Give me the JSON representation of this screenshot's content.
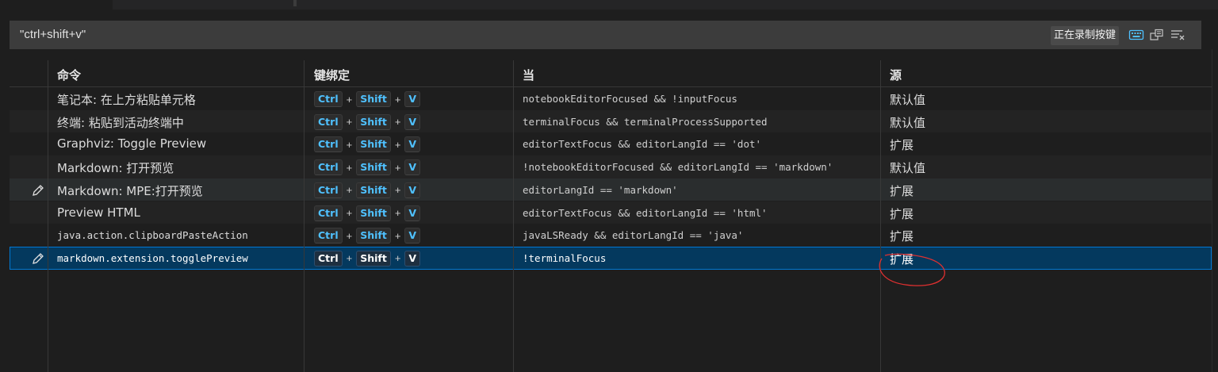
{
  "search": {
    "query": "\"ctrl+shift+v\"",
    "recording_label": "正在录制按键"
  },
  "icons": {
    "keyboard": "keyboard-icon",
    "sort": "sort-by-precedence-icon",
    "clear": "clear-icon",
    "edit": "pencil-icon"
  },
  "colors": {
    "accent": "#4fc1ff",
    "selection": "#04395e",
    "focus_border": "#0078d4",
    "annotation": "#e03030"
  },
  "table": {
    "headers": {
      "command": "命令",
      "keybinding": "键绑定",
      "when": "当",
      "source": "源"
    },
    "rows": [
      {
        "command": "笔记本: 在上方粘贴单元格",
        "keys": [
          "Ctrl",
          "Shift",
          "V"
        ],
        "when": "notebookEditorFocused && !inputFocus",
        "source": "默认值"
      },
      {
        "command": "终端: 粘贴到活动终端中",
        "keys": [
          "Ctrl",
          "Shift",
          "V"
        ],
        "when": "terminalFocus && terminalProcessSupported",
        "source": "默认值"
      },
      {
        "command": "Graphviz: Toggle Preview",
        "keys": [
          "Ctrl",
          "Shift",
          "V"
        ],
        "when": "editorTextFocus && editorLangId == 'dot'",
        "source": "扩展"
      },
      {
        "command": "Markdown: 打开预览",
        "keys": [
          "Ctrl",
          "Shift",
          "V"
        ],
        "when": "!notebookEditorFocused && editorLangId == 'markdown'",
        "source": "默认值"
      },
      {
        "command": "Markdown: MPE:打开预览",
        "keys": [
          "Ctrl",
          "Shift",
          "V"
        ],
        "when": "editorLangId == 'markdown'",
        "source": "扩展"
      },
      {
        "command": "Preview HTML",
        "keys": [
          "Ctrl",
          "Shift",
          "V"
        ],
        "when": "editorTextFocus && editorLangId == 'html'",
        "source": "扩展"
      },
      {
        "command": "java.action.clipboardPasteAction",
        "keys": [
          "Ctrl",
          "Shift",
          "V"
        ],
        "when": "javaLSReady && editorLangId == 'java'",
        "source": "扩展"
      },
      {
        "command": "markdown.extension.togglePreview",
        "keys": [
          "Ctrl",
          "Shift",
          "V"
        ],
        "when": "!terminalFocus",
        "source": "扩展"
      }
    ]
  }
}
